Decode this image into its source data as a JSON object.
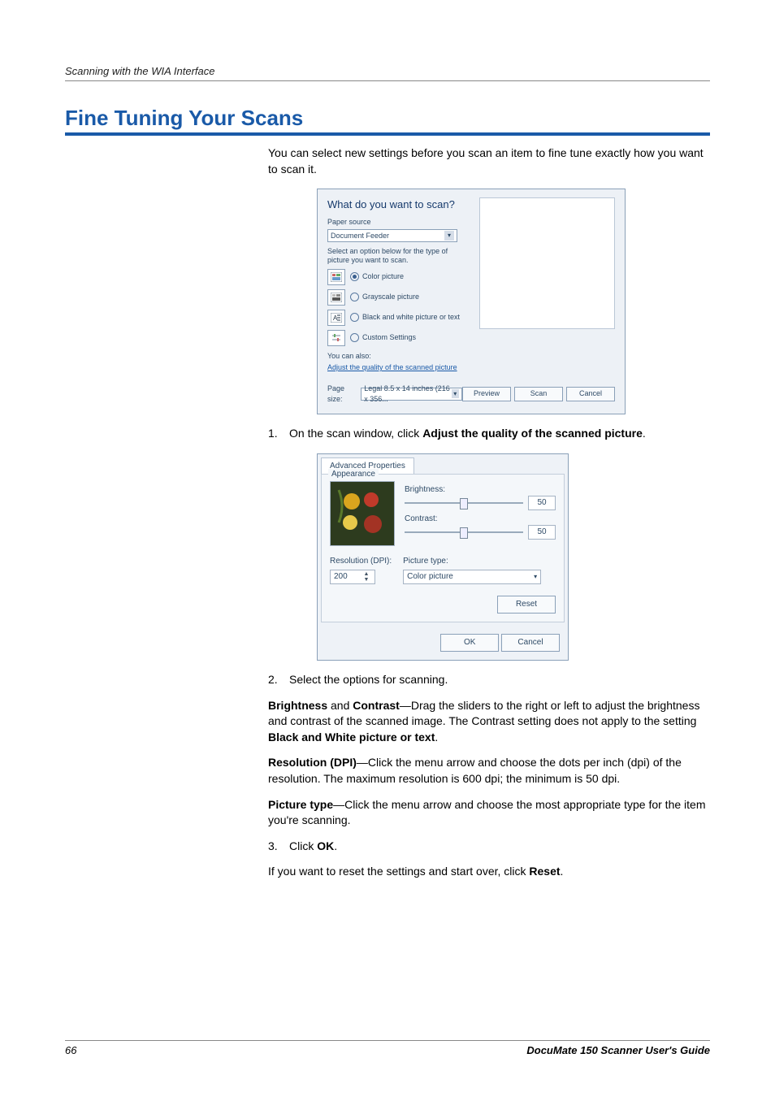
{
  "header": {
    "running": "Scanning with the WIA Interface"
  },
  "title": "Fine Tuning Your Scans",
  "intro": "You can select new settings before you scan an item to fine tune exactly how you want to scan it.",
  "scan_dialog": {
    "title": "What do you want to scan?",
    "paper_source_label": "Paper source",
    "paper_source_value": "Document Feeder",
    "help_text": "Select an option below for the type of picture you want to scan.",
    "options": {
      "color": "Color picture",
      "gray": "Grayscale picture",
      "bw": "Black and white picture or text",
      "custom": "Custom Settings"
    },
    "you_can_also": "You can also:",
    "adjust_link": "Adjust the quality of the scanned picture",
    "page_size_label": "Page size:",
    "page_size_value": "Legal 8.5 x 14 inches (216 x 356...",
    "buttons": {
      "preview": "Preview",
      "scan": "Scan",
      "cancel": "Cancel"
    }
  },
  "step1_pre": "On the scan window, click ",
  "step1_bold": "Adjust the quality of the scanned picture",
  "adv_dialog": {
    "tab": "Advanced Properties",
    "group": "Appearance",
    "brightness_label": "Brightness:",
    "brightness_value": "50",
    "contrast_label": "Contrast:",
    "contrast_value": "50",
    "resolution_label": "Resolution (DPI):",
    "resolution_value": "200",
    "picture_type_label": "Picture type:",
    "picture_type_value": "Color picture",
    "reset": "Reset",
    "ok": "OK",
    "cancel": "Cancel"
  },
  "step2": "Select the options for scanning.",
  "step2_paras": {
    "bc_lead_b": "Brightness",
    "bc_and": " and ",
    "bc_lead_c": "Contrast",
    "bc_text_a": "—Drag the sliders to the right or left to adjust the brightness and contrast of the scanned image. The Contrast setting does not apply to the setting ",
    "bc_bold2": "Black and White picture or text",
    "res_lead": "Resolution (DPI)",
    "res_text": "—Click the menu arrow and choose the dots per inch (dpi) of the resolution. The maximum resolution is 600 dpi; the minimum is 50 dpi.",
    "pt_lead": "Picture type",
    "pt_text": "—Click the menu arrow and choose the most appropriate type for the item you're scanning."
  },
  "step3_pre": "Click ",
  "step3_bold": "OK",
  "step3_after": "If you want to reset the settings and start over, click ",
  "step3_after_bold": "Reset",
  "footer": {
    "page": "66",
    "guide": "DocuMate 150 Scanner User's Guide"
  }
}
